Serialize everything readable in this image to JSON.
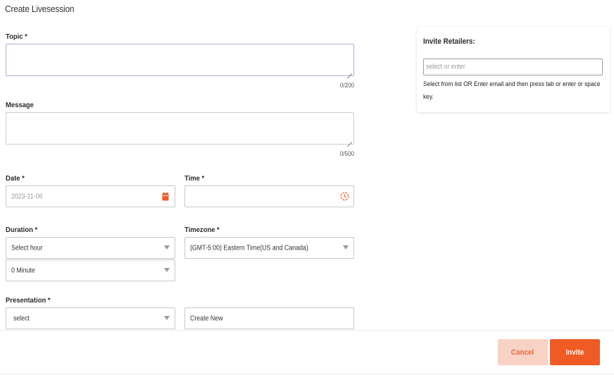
{
  "page": {
    "title": "Create Livesession"
  },
  "form": {
    "topic": {
      "label": "Topic *",
      "counter": "0/200"
    },
    "message": {
      "label": "Message",
      "counter": "0/500"
    },
    "date": {
      "label": "Date *",
      "value": "2023-11-06"
    },
    "time": {
      "label": "Time *",
      "value": ""
    },
    "duration": {
      "label": "Duration *",
      "hours_value": "Select hour",
      "minutes_value": "0 Minute"
    },
    "timezone": {
      "label": "Timezone *",
      "value": "(GMT-5:00) Eastern Time(US and Canada)"
    },
    "presentation": {
      "label": "Presentation *",
      "value": "select",
      "create_new": "Create New"
    }
  },
  "invite": {
    "title": "Invite Retailers:",
    "placeholder": "select or enter",
    "help": "Select from list OR Enter email and then press tab or enter or space key."
  },
  "footer": {
    "cancel_label": "Cancel",
    "invite_label": "Invite"
  },
  "colors": {
    "accent": "#f05a24",
    "accent_light": "#f9d2c6",
    "icon": "#f05a24"
  },
  "icons": {
    "date": "calendar-icon",
    "time": "clock-icon",
    "dropdown": "chevron-down-icon"
  }
}
